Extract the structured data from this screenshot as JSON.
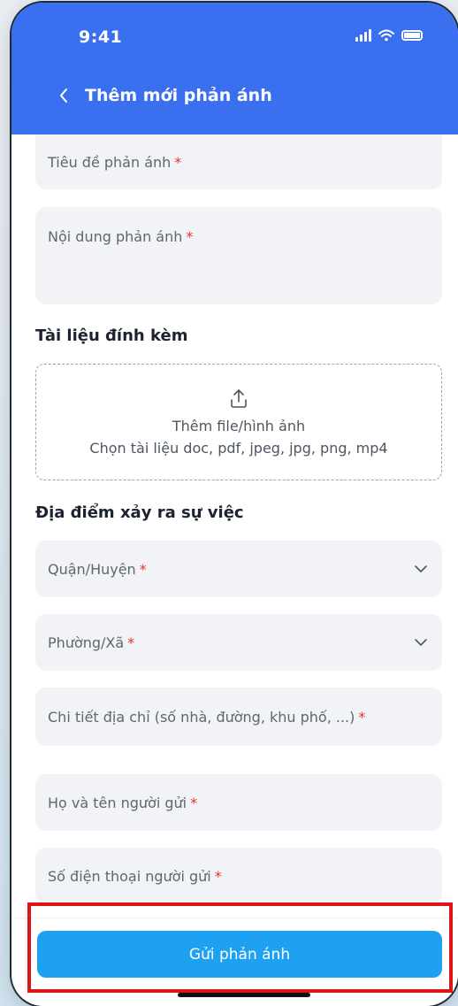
{
  "status_bar": {
    "time": "9:41"
  },
  "header": {
    "title": "Thêm mới phản ánh"
  },
  "form": {
    "title_placeholder": "Tiêu đề phản ánh",
    "content_placeholder": "Nội dung phản ánh",
    "required_mark": "*",
    "attachments": {
      "section_title": "Tài liệu đính kèm",
      "upload_label": "Thêm file/hình ảnh",
      "upload_hint": "Chọn tài liệu doc, pdf, jpeg, jpg, png, mp4"
    },
    "location": {
      "section_title": "Địa điểm xảy ra sự việc",
      "district_placeholder": "Quận/Huyện",
      "ward_placeholder": "Phường/Xã",
      "address_placeholder": "Chi tiết địa chỉ (số nhà, đường, khu phố, ...)"
    },
    "sender_name_placeholder": "Họ và tên người gửi",
    "sender_phone_placeholder": "Số điện thoại người gửi"
  },
  "footer": {
    "submit_label": "Gửi phản ánh"
  },
  "colors": {
    "header_bg": "#3a6ff0",
    "submit_bg": "#1ea1f0",
    "required": "#e5322d",
    "highlight": "#e01414"
  }
}
